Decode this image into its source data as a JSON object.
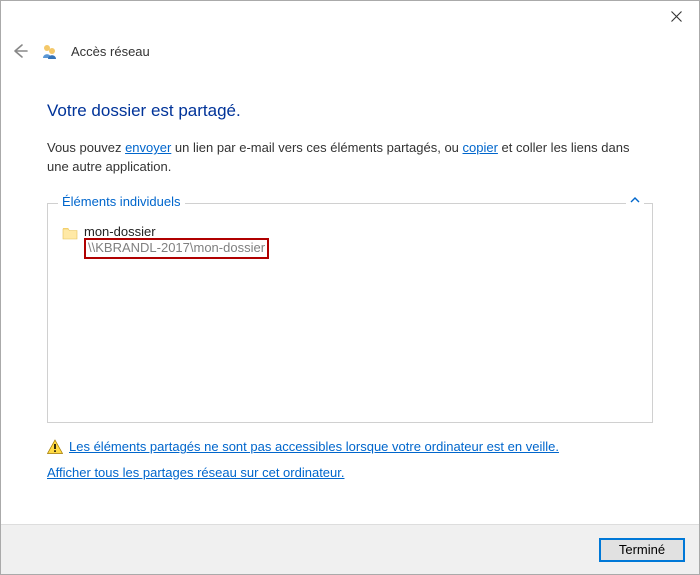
{
  "window": {
    "title": "Accès réseau"
  },
  "page": {
    "heading": "Votre dossier est partagé.",
    "desc_part1": "Vous pouvez ",
    "link_envoyer": "envoyer",
    "desc_part2": " un lien par e-mail vers ces éléments partagés, ou ",
    "link_copier": "copier",
    "desc_part3": " et coller les liens dans une autre application."
  },
  "group": {
    "legend": "Éléments individuels",
    "item": {
      "name": "mon-dossier",
      "path": "\\\\KBRANDL-2017\\mon-dossier"
    }
  },
  "links": {
    "sleep_warning": "Les éléments partagés ne sont pas accessibles lorsque votre ordinateur est en veille.",
    "show_all": "Afficher tous les partages réseau sur cet ordinateur."
  },
  "footer": {
    "done": "Terminé"
  }
}
